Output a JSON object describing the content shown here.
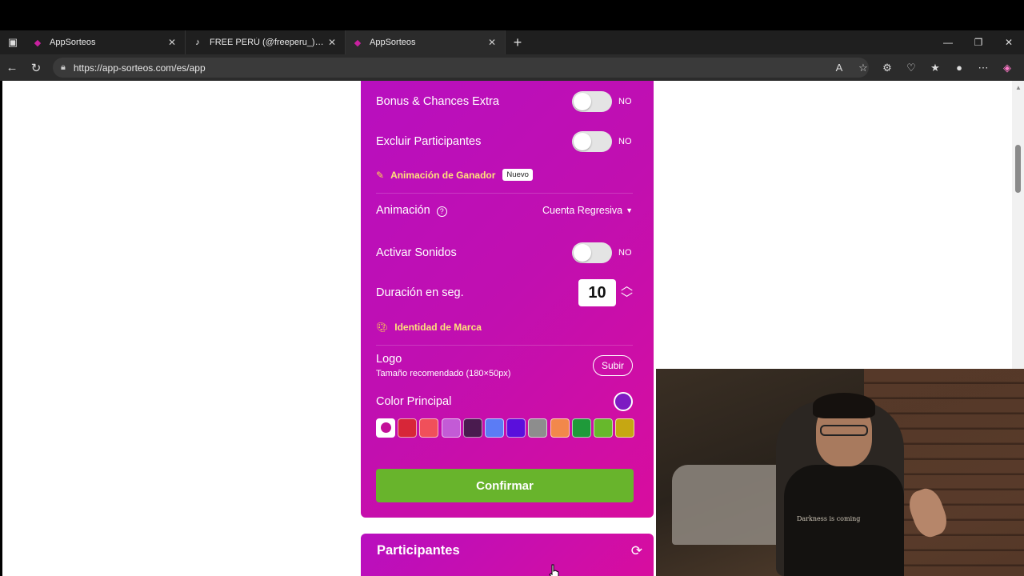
{
  "browser": {
    "tabs": [
      {
        "title": "AppSorteos",
        "icon": "appsorteos-favicon"
      },
      {
        "title": "FREE PERÚ (@freeperu_) | TikTok",
        "icon": "tiktok-favicon"
      },
      {
        "title": "AppSorteos",
        "icon": "appsorteos-favicon",
        "active": true
      }
    ],
    "url": "https://app-sorteos.com/es/app"
  },
  "settings": {
    "bonus_label": "Bonus & Chances Extra",
    "bonus_state": "NO",
    "excluir_label": "Excluir Participantes",
    "excluir_state": "NO",
    "animacion_section": "Animación de Ganador",
    "nuevo_badge": "Nuevo",
    "animacion_label": "Animación",
    "animacion_value": "Cuenta Regresiva",
    "sonidos_label": "Activar Sonidos",
    "sonidos_state": "NO",
    "duracion_label": "Duración en seg.",
    "duracion_value": "10",
    "marca_section": "Identidad de Marca",
    "logo_label": "Logo",
    "logo_hint": "Tamaño recomendado (180×50px)",
    "subir_label": "Subir",
    "color_label": "Color Principal",
    "selected_color": "#7d1bc2",
    "swatch_colors": [
      "#ffffff",
      "#d72638",
      "#f0505a",
      "#c35bd6",
      "#4a1b4f",
      "#5b7cf5",
      "#5a0fdc",
      "#8d8d8d",
      "#f2884b",
      "#1f9a3a",
      "#67b82c",
      "#c6a712"
    ],
    "confirm_label": "Confirmar"
  },
  "participantes": {
    "title": "Participantes"
  },
  "webcam": {
    "shirt_text": "Darkness is coming"
  }
}
